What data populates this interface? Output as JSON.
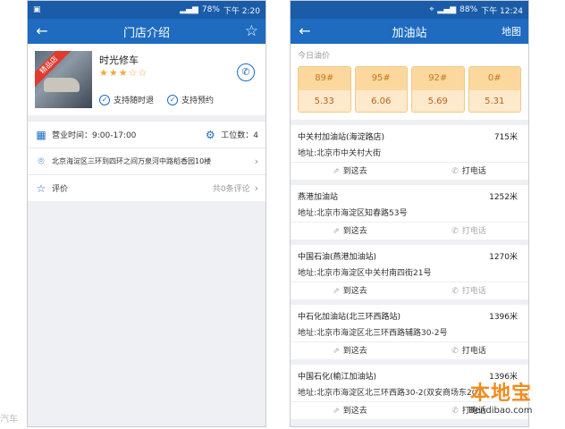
{
  "phoneA": {
    "status": {
      "time": "下午 2:20",
      "battery": "78%"
    },
    "nav": {
      "title": "门店介绍",
      "back_icon": "back-arrow-icon",
      "star_icon": "star-outline-icon"
    },
    "shop": {
      "name": "时光修车",
      "badge": "精品店",
      "stars": "★★★☆☆",
      "tags": [
        "支持随时退",
        "支持预约"
      ]
    },
    "hours": {
      "label": "营业时间：9:00-17:00",
      "stations_label": "工位数：4"
    },
    "address": "北京海淀区三环到四环之间万泉河中路稻香园10楼",
    "review": {
      "label": "评价",
      "count": "共0条评论"
    },
    "footer_text": "汽车"
  },
  "phoneB": {
    "status": {
      "time": "下午 12:24",
      "battery": "88%"
    },
    "nav": {
      "title": "加油站",
      "right": "地图"
    },
    "today_label": "今日油价",
    "prices": [
      {
        "grade": "89#",
        "price": "5.33"
      },
      {
        "grade": "95#",
        "price": "6.06"
      },
      {
        "grade": "92#",
        "price": "5.69"
      },
      {
        "grade": "0#",
        "price": "5.31"
      }
    ],
    "actions": {
      "go": "到这去",
      "call": "打电话"
    },
    "stations": [
      {
        "name": "中关村加油站(海淀路店)",
        "distance": "715米",
        "address": "地址:北京市中关村大街"
      },
      {
        "name": "燕港加油站",
        "distance": "1252米",
        "address": "地址:北京市海淀区知春路53号"
      },
      {
        "name": "中国石油(燕港加油站)",
        "distance": "1270米",
        "address": "地址:北京市海淀区中关村南四街21号"
      },
      {
        "name": "中石化加油站(北三环西路站)",
        "distance": "1396米",
        "address": "地址:北京市海淀区北三环西路辅路30-2号"
      },
      {
        "name": "中国石化(榆江加油站)",
        "distance": "1396米",
        "address": "地址:北京市海淀区北三环西路30-2(双安商场东200"
      }
    ]
  },
  "watermark": {
    "big": "本地宝",
    "small": "Bendibao.com"
  },
  "colors": {
    "nav": "#1e6bc0",
    "status": "#1a5ca8",
    "price_card": "#fde7c7",
    "watermark": "#f28a1d"
  }
}
